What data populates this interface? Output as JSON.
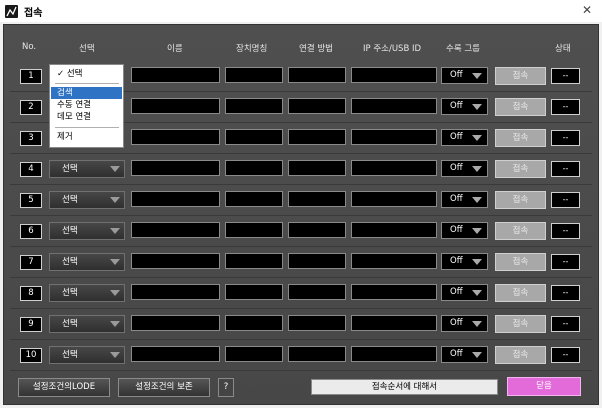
{
  "window": {
    "title": "접속",
    "close_glyph": "✕"
  },
  "headers": {
    "no": "No.",
    "select": "선택",
    "name": "이름",
    "device_name": "장치명칭",
    "conn_method": "연결 방법",
    "ip": "IP 주소/USB ID",
    "recv_group": "수록 그룹",
    "status": "상태"
  },
  "rows": [
    {
      "no": "1",
      "select": "선택",
      "group": "Off",
      "connect": "접속",
      "status": "--"
    },
    {
      "no": "2",
      "select": "선택",
      "group": "Off",
      "connect": "접속",
      "status": "--"
    },
    {
      "no": "3",
      "select": "선택",
      "group": "Off",
      "connect": "접속",
      "status": "--"
    },
    {
      "no": "4",
      "select": "선택",
      "group": "Off",
      "connect": "접속",
      "status": "--"
    },
    {
      "no": "5",
      "select": "선택",
      "group": "Off",
      "connect": "접속",
      "status": "--"
    },
    {
      "no": "6",
      "select": "선택",
      "group": "Off",
      "connect": "접속",
      "status": "--"
    },
    {
      "no": "7",
      "select": "선택",
      "group": "Off",
      "connect": "접속",
      "status": "--"
    },
    {
      "no": "8",
      "select": "선택",
      "group": "Off",
      "connect": "접속",
      "status": "--"
    },
    {
      "no": "9",
      "select": "선택",
      "group": "Off",
      "connect": "접속",
      "status": "--"
    },
    {
      "no": "10",
      "select": "선택",
      "group": "Off",
      "connect": "접속",
      "status": "--"
    }
  ],
  "dropdown": {
    "items": [
      {
        "label": "✓ 선택",
        "highlighted": false
      },
      {
        "label": "검색",
        "highlighted": true
      },
      {
        "label": "수동 연결",
        "highlighted": false
      },
      {
        "label": "데모 연결",
        "highlighted": false
      },
      {
        "label": "제거",
        "highlighted": false
      }
    ]
  },
  "footer": {
    "load_label": "설정조건의LODE",
    "save_label": "설정조건의 보존",
    "help_label": "?",
    "info_text": "접속순서에 대해서",
    "close_label": "닫음"
  },
  "colors": {
    "panel": "#4a4a4a",
    "highlight": "#2f73c4",
    "close_button": "#e26ad9"
  }
}
